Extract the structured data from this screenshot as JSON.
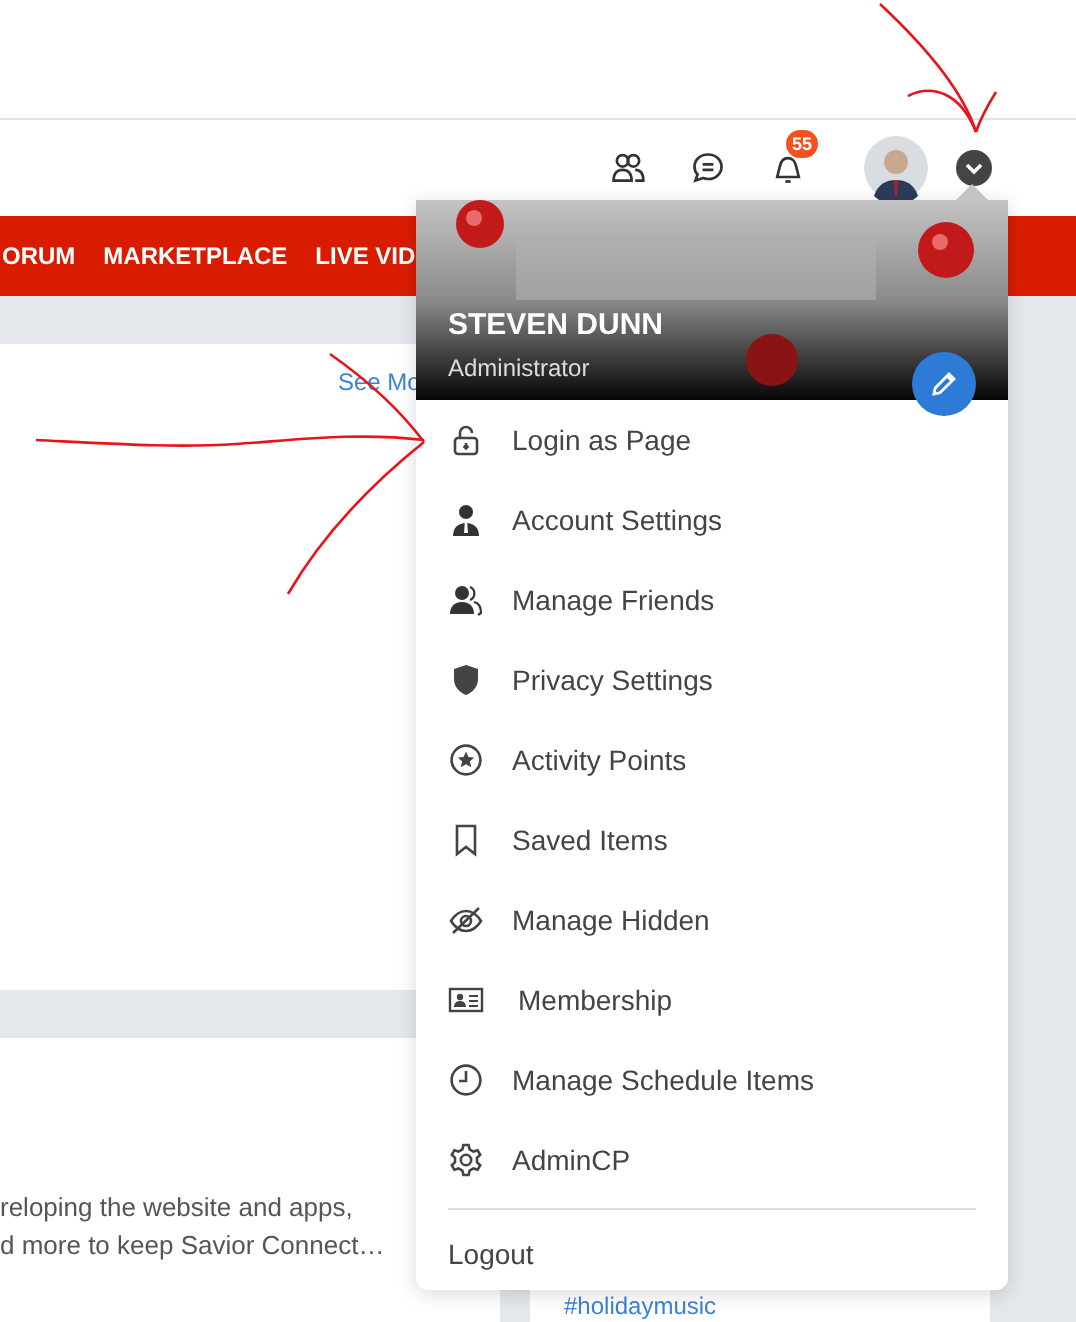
{
  "header": {
    "notification_count": "55"
  },
  "nav": [
    "ORUM",
    "MARKETPLACE",
    "LIVE VID"
  ],
  "card": {
    "link": "See Mo"
  },
  "post": {
    "lines": [
      "reloping the website and apps,",
      "d more to keep Savior Connect…"
    ]
  },
  "sidebar": {
    "tag": "#holidaymusic"
  },
  "menu": {
    "name": "STEVEN DUNN",
    "role": "Administrator",
    "items": [
      {
        "label": "Login as Page",
        "kind": "lock"
      },
      {
        "label": "Account Settings",
        "kind": "user"
      },
      {
        "label": "Manage Friends",
        "kind": "users"
      },
      {
        "label": "Privacy Settings",
        "kind": "shield"
      },
      {
        "label": "Activity Points",
        "kind": "star"
      },
      {
        "label": "Saved Items",
        "kind": "bookmark"
      },
      {
        "label": "Manage Hidden",
        "kind": "hidden"
      },
      {
        "label": "Membership",
        "kind": "card"
      },
      {
        "label": "Manage Schedule Items",
        "kind": "clock"
      },
      {
        "label": "AdminCP",
        "kind": "gear"
      }
    ],
    "logout": "Logout"
  }
}
